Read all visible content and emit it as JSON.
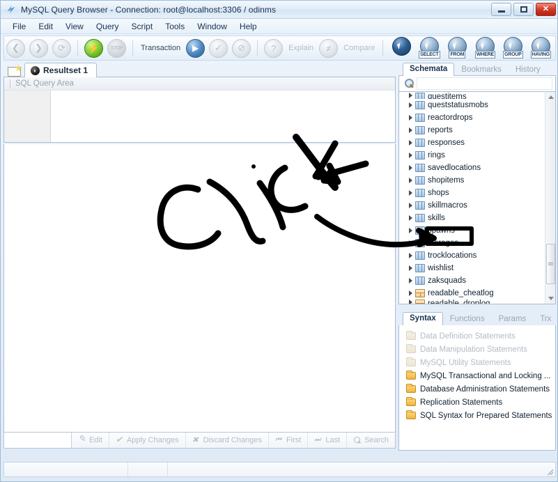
{
  "window": {
    "title": "MySQL Query Browser - Connection: root@localhost:3306 / odinms",
    "app_icon": "mysql-lightning-icon",
    "controls": {
      "minimize": "—",
      "maximize": "□",
      "close": "✕"
    }
  },
  "menubar": {
    "items": [
      "File",
      "Edit",
      "View",
      "Query",
      "Script",
      "Tools",
      "Window",
      "Help"
    ]
  },
  "toolbar": {
    "back_icon": "back-arrow-icon",
    "forward_icon": "forward-arrow-icon",
    "refresh_icon": "refresh-icon",
    "execute_icon": "execute-lightning-icon",
    "stop_label": "STOP",
    "transaction_label": "Transaction",
    "start_transaction_icon": "play-icon",
    "commit_icon": "commit-check-icon",
    "rollback_icon": "rollback-icon",
    "explain_label": "Explain",
    "compare_label": "Compare",
    "query_buttons": [
      {
        "tag": "",
        "name": "pointer-button",
        "dark": true
      },
      {
        "tag": "SELECT",
        "name": "select-button",
        "dark": false
      },
      {
        "tag": "FROM",
        "name": "from-button",
        "dark": false
      },
      {
        "tag": "WHERE",
        "name": "where-button",
        "dark": false
      },
      {
        "tag": "GROUP",
        "name": "group-button",
        "dark": false
      },
      {
        "tag": "HAVING",
        "name": "having-button",
        "dark": false
      }
    ]
  },
  "editor": {
    "new_tab_icon": "new-script-tab-icon",
    "tab_label": "Resultset 1",
    "tab_badge": "◔",
    "query_area_placeholder": "SQL Query Area",
    "query_area_value": ""
  },
  "result_toolbar": {
    "search_value": "",
    "buttons": [
      {
        "label": "Edit",
        "icon": "pencil-icon"
      },
      {
        "label": "Apply Changes",
        "icon": "check-icon"
      },
      {
        "label": "Discard Changes",
        "icon": "x-icon"
      },
      {
        "label": "First",
        "icon": "first-record-icon"
      },
      {
        "label": "Last",
        "icon": "last-record-icon"
      },
      {
        "label": "Search",
        "icon": "magnifier-icon"
      }
    ]
  },
  "right_panel": {
    "tabs": [
      {
        "label": "Schemata",
        "active": true
      },
      {
        "label": "Bookmarks",
        "active": false
      },
      {
        "label": "History",
        "active": false
      }
    ],
    "search_icon": "magnifier-icon",
    "search_value": "",
    "tree_items": [
      {
        "label": "questitems",
        "type": "table",
        "clipped": true,
        "highlighted": false
      },
      {
        "label": "queststatusmobs",
        "type": "table",
        "clipped": false,
        "highlighted": false
      },
      {
        "label": "reactordrops",
        "type": "table",
        "clipped": false,
        "highlighted": false
      },
      {
        "label": "reports",
        "type": "table",
        "clipped": false,
        "highlighted": false
      },
      {
        "label": "responses",
        "type": "table",
        "clipped": false,
        "highlighted": false
      },
      {
        "label": "rings",
        "type": "table",
        "clipped": false,
        "highlighted": false
      },
      {
        "label": "savedlocations",
        "type": "table",
        "clipped": false,
        "highlighted": false
      },
      {
        "label": "shopitems",
        "type": "table",
        "clipped": false,
        "highlighted": false
      },
      {
        "label": "shops",
        "type": "table",
        "clipped": false,
        "highlighted": false
      },
      {
        "label": "skillmacros",
        "type": "table",
        "clipped": false,
        "highlighted": false
      },
      {
        "label": "skills",
        "type": "table",
        "clipped": false,
        "highlighted": false
      },
      {
        "label": "spawns",
        "type": "table",
        "clipped": false,
        "highlighted": true
      },
      {
        "label": "storages",
        "type": "table",
        "clipped": false,
        "highlighted": false
      },
      {
        "label": "trocklocations",
        "type": "table",
        "clipped": false,
        "highlighted": false
      },
      {
        "label": "wishlist",
        "type": "table",
        "clipped": false,
        "highlighted": false
      },
      {
        "label": "zaksquads",
        "type": "table",
        "clipped": false,
        "highlighted": false
      },
      {
        "label": "readable_cheatlog",
        "type": "view",
        "clipped": false,
        "highlighted": false
      },
      {
        "label": "readable_droplog",
        "type": "view",
        "clipped": true,
        "highlighted": false
      }
    ],
    "scrollbar": {
      "up_icon": "scroll-up-icon",
      "down_icon": "scroll-down-icon"
    }
  },
  "bottom_panel": {
    "tabs": [
      {
        "label": "Syntax",
        "active": true
      },
      {
        "label": "Functions",
        "active": false
      },
      {
        "label": "Params",
        "active": false
      },
      {
        "label": "Trx",
        "active": false
      }
    ],
    "items": [
      {
        "label": "Data Definition Statements",
        "enabled": false
      },
      {
        "label": "Data Manipulation Statements",
        "enabled": false
      },
      {
        "label": "MySQL Utility Statements",
        "enabled": false
      },
      {
        "label": "MySQL Transactional and Locking ...",
        "enabled": true
      },
      {
        "label": "Database Administration Statements",
        "enabled": true
      },
      {
        "label": "Replication Statements",
        "enabled": true
      },
      {
        "label": "SQL Syntax for Prepared Statements",
        "enabled": true
      }
    ]
  },
  "statusbar": {
    "cells": [
      "",
      "",
      ""
    ]
  },
  "annotation": {
    "text": "click",
    "color": "#000000",
    "description": "handwritten word 'click' with two arrows pointing at the spawns table"
  }
}
